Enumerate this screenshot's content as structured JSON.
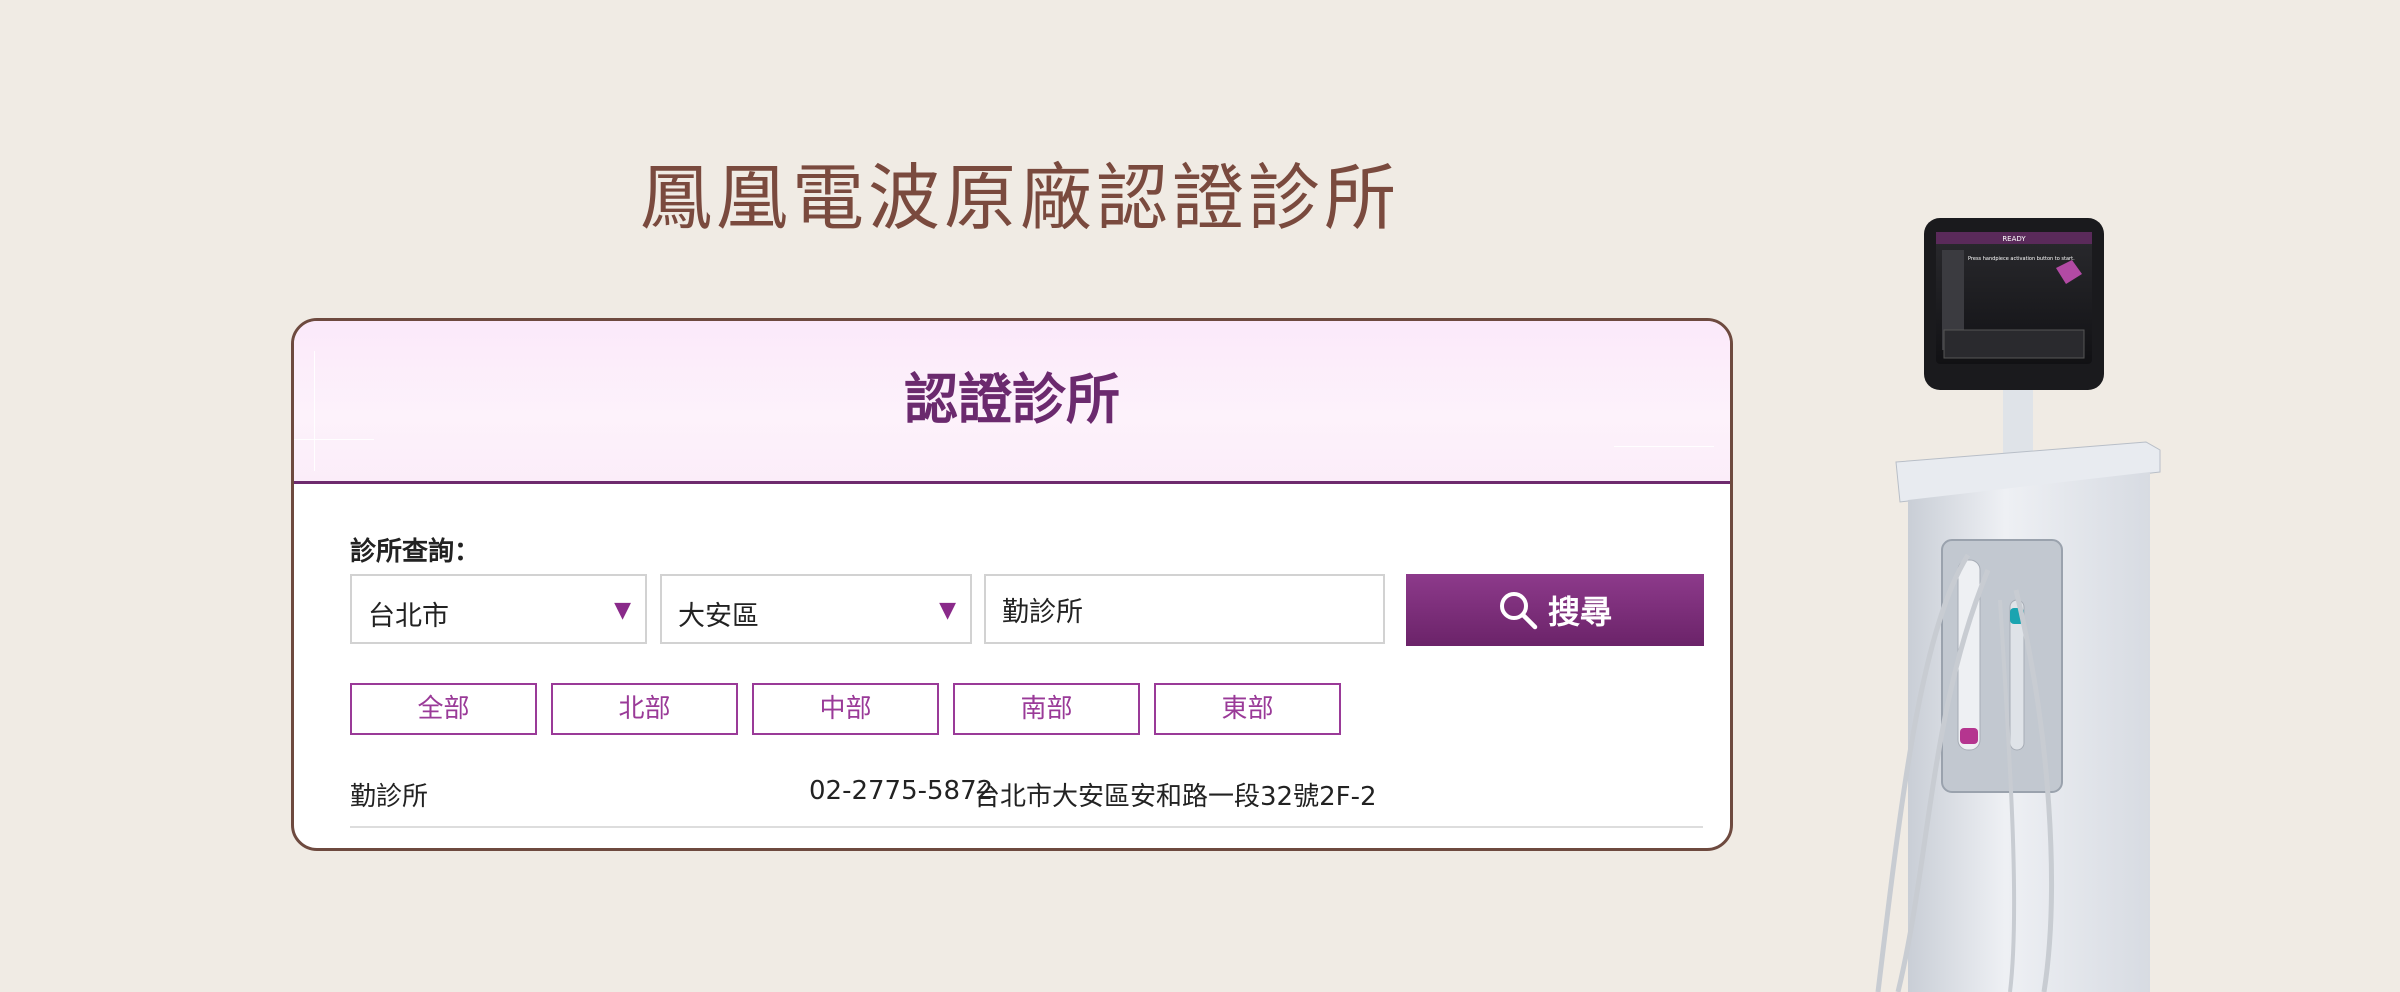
{
  "page": {
    "title": "鳳凰電波原廠認證診所"
  },
  "card": {
    "title": "認證診所",
    "search_label": "診所查詢：",
    "city_select": {
      "value": "台北市"
    },
    "district_select": {
      "value": "大安區"
    },
    "keyword_input": {
      "value": "勤診所",
      "placeholder": ""
    },
    "search_button": {
      "label": "搜尋",
      "icon": "search-icon"
    },
    "regions": [
      "全部",
      "北部",
      "中部",
      "南部",
      "東部"
    ],
    "results": [
      {
        "name": "勤診所",
        "phone": "02-2775-5872",
        "address": "台北市大安區安和路一段32號2F-2"
      }
    ]
  },
  "device_screen": {
    "status": "READY",
    "message": "Press handpiece activation button to start."
  },
  "colors": {
    "background": "#f0ebe4",
    "title_brown": "#7a4a3e",
    "accent_purple": "#6b2a6e",
    "tab_purple": "#9a3a98"
  }
}
